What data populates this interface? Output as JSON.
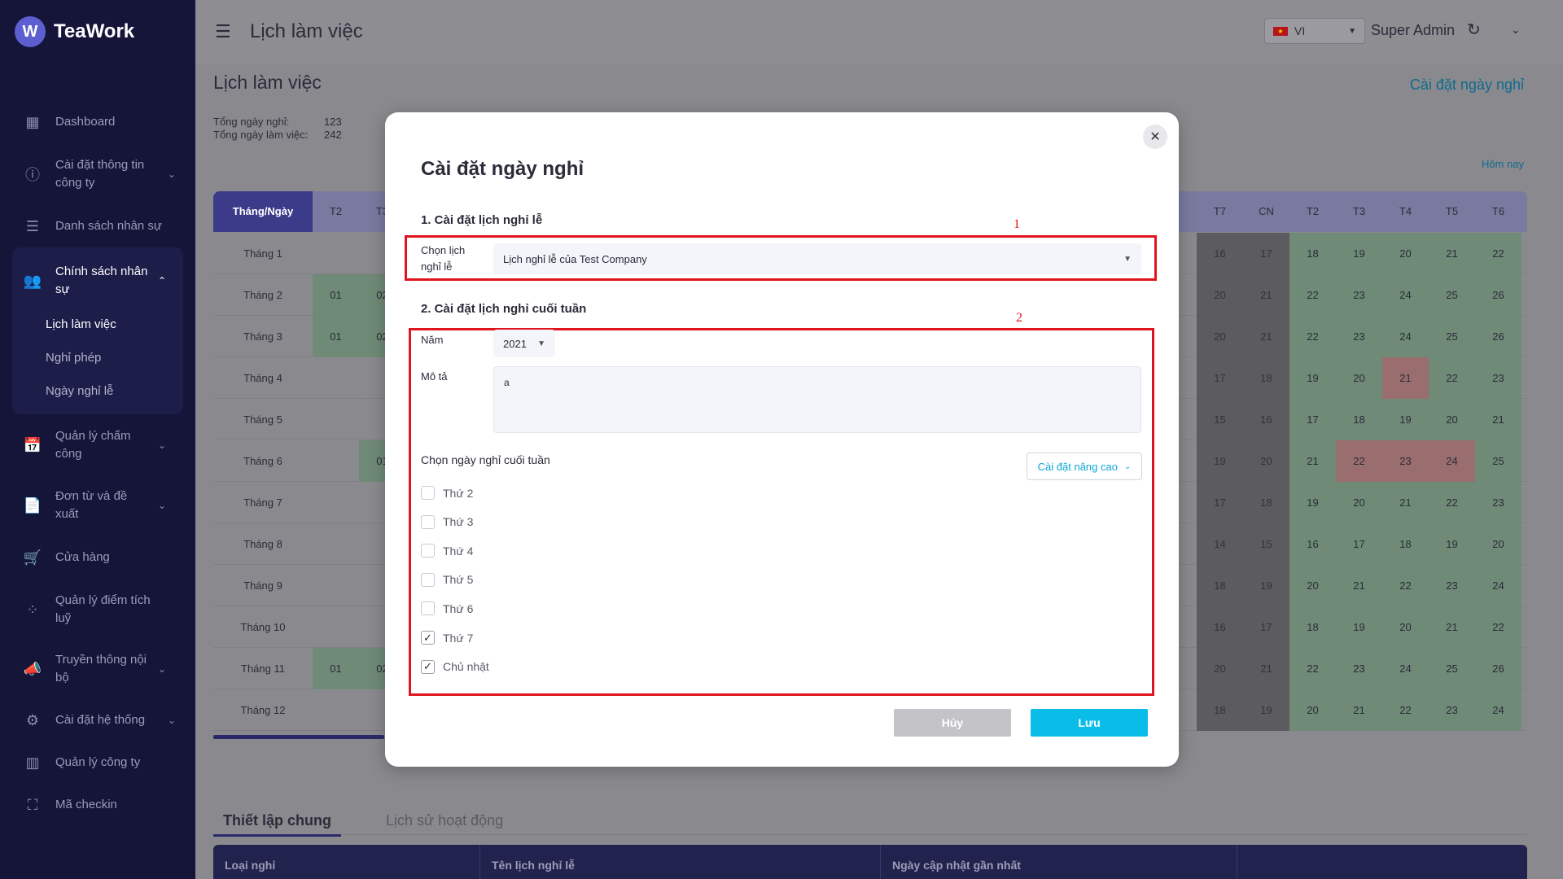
{
  "app": {
    "logo_letter": "W",
    "name": "TeaWork"
  },
  "sidebar": {
    "items": [
      {
        "label": "Dashboard",
        "icon": "dashboard-icon"
      },
      {
        "label": "Cài đặt thông tin công ty",
        "icon": "info-icon"
      },
      {
        "label": "Danh sách nhân sự",
        "icon": "list-icon"
      },
      {
        "label": "Chính sách nhân sự",
        "icon": "users-icon"
      },
      {
        "label": "Quản lý chấm công",
        "icon": "calendar-clock-icon"
      },
      {
        "label": "Đơn từ và đề xuất",
        "icon": "document-icon"
      },
      {
        "label": "Cửa hàng",
        "icon": "cart-icon"
      },
      {
        "label": "Quản lý điểm tích luỹ",
        "icon": "points-icon"
      },
      {
        "label": "Truyền thông nội bộ",
        "icon": "megaphone-icon"
      },
      {
        "label": "Cài đặt hệ thống",
        "icon": "gears-icon"
      },
      {
        "label": "Quản lý công ty",
        "icon": "building-icon"
      },
      {
        "label": "Mã checkin",
        "icon": "scan-icon"
      }
    ],
    "sub_items": [
      "Lịch làm việc",
      "Nghỉ phép",
      "Ngày nghỉ lễ"
    ]
  },
  "header": {
    "title": "Lịch làm việc",
    "language": "VI",
    "user": "Super Admin"
  },
  "main": {
    "page_title": "Lịch làm việc",
    "stats": [
      {
        "label": "Tổng ngày nghỉ:",
        "value": "123"
      },
      {
        "label": "Tổng ngày làm việc:",
        "value": "242"
      }
    ],
    "holiday_link": "Cài đặt ngày nghỉ",
    "today_link": "Hôm nay"
  },
  "calendar": {
    "header_first": "Tháng/Ngày",
    "left_headers": [
      "T2",
      "T3"
    ],
    "right_headers": [
      "T7",
      "CN",
      "T2",
      "T3",
      "T4",
      "T5",
      "T6"
    ],
    "months": [
      "Tháng 1",
      "Tháng 2",
      "Tháng 3",
      "Tháng 4",
      "Tháng 5",
      "Tháng 6",
      "Tháng 7",
      "Tháng 8",
      "Tháng 9",
      "Tháng 10",
      "Tháng 11",
      "Tháng 12"
    ],
    "left_cells": [
      [
        "",
        ""
      ],
      [
        "01",
        "02"
      ],
      [
        "01",
        "02"
      ],
      [
        "",
        ""
      ],
      [
        "",
        ""
      ],
      [
        "",
        "01"
      ],
      [
        "",
        ""
      ],
      [
        "",
        ""
      ],
      [
        "",
        ""
      ],
      [
        "",
        ""
      ],
      [
        "01",
        "02"
      ],
      [
        "",
        ""
      ]
    ],
    "right_cells": [
      [
        "16",
        "17",
        "18",
        "19",
        "20",
        "21",
        "22"
      ],
      [
        "20",
        "21",
        "22",
        "23",
        "24",
        "25",
        "26"
      ],
      [
        "20",
        "21",
        "22",
        "23",
        "24",
        "25",
        "26"
      ],
      [
        "17",
        "18",
        "19",
        "20",
        "21",
        "22",
        "23"
      ],
      [
        "15",
        "16",
        "17",
        "18",
        "19",
        "20",
        "21"
      ],
      [
        "19",
        "20",
        "21",
        "22",
        "23",
        "24",
        "25"
      ],
      [
        "17",
        "18",
        "19",
        "20",
        "21",
        "22",
        "23"
      ],
      [
        "14",
        "15",
        "16",
        "17",
        "18",
        "19",
        "20"
      ],
      [
        "18",
        "19",
        "20",
        "21",
        "22",
        "23",
        "24"
      ],
      [
        "16",
        "17",
        "18",
        "19",
        "20",
        "21",
        "22"
      ],
      [
        "20",
        "21",
        "22",
        "23",
        "24",
        "25",
        "26"
      ],
      [
        "18",
        "19",
        "20",
        "21",
        "22",
        "23",
        "24"
      ]
    ],
    "red_cells": [
      [
        3,
        4
      ],
      [
        5,
        3
      ],
      [
        5,
        4
      ],
      [
        5,
        5
      ]
    ]
  },
  "tabs": [
    "Thiết lập chung",
    "Lịch sử hoạt động"
  ],
  "table_headers": [
    "Loại nghỉ",
    "Tên lịch nghỉ lễ",
    "Ngày cập nhật gần nhất"
  ],
  "modal": {
    "title": "Cài đặt ngày nghỉ",
    "close_glyph": "✕",
    "section1": "1. Cài đặt lịch nghỉ lễ",
    "section2": "2. Cài đặt lịch nghỉ cuối tuần",
    "annotation1": "1",
    "annotation2": "2",
    "holiday_label": "Chọn lịch nghỉ lễ",
    "holiday_value": "Lịch nghỉ lễ của Test Company",
    "year_label": "Năm",
    "year_value": "2021",
    "desc_label": "Mô tả",
    "desc_value": "a",
    "weekend_label": "Chọn ngày nghỉ cuối tuần",
    "advanced_label": "Cài đặt nâng cao",
    "days": [
      {
        "label": "Thứ 2",
        "checked": false
      },
      {
        "label": "Thứ 3",
        "checked": false
      },
      {
        "label": "Thứ 4",
        "checked": false
      },
      {
        "label": "Thứ 5",
        "checked": false
      },
      {
        "label": "Thứ 6",
        "checked": false
      },
      {
        "label": "Thứ 7",
        "checked": true
      },
      {
        "label": "Chủ nhật",
        "checked": true
      }
    ],
    "cancel_label": "Hủy",
    "save_label": "Lưu"
  }
}
